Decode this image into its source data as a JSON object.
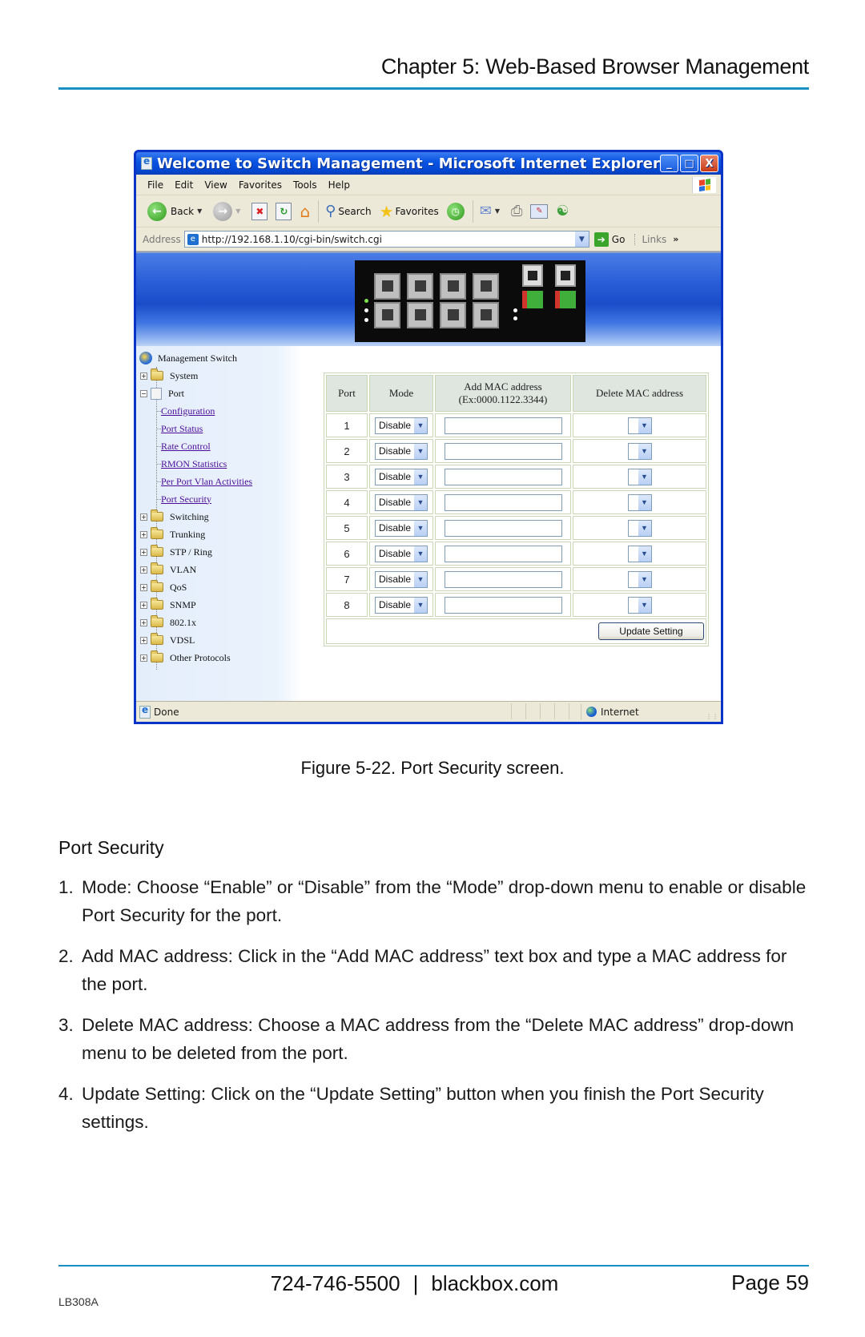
{
  "page_header": {
    "title": "Chapter 5: Web-Based Browser Management"
  },
  "browser": {
    "title": "Welcome to Switch Management - Microsoft Internet Explorer",
    "window_buttons": {
      "minimize": "_",
      "maximize": "□",
      "close": "X"
    },
    "menu": [
      "File",
      "Edit",
      "View",
      "Favorites",
      "Tools",
      "Help"
    ],
    "toolbar": {
      "back": "Back",
      "search": "Search",
      "favorites": "Favorites"
    },
    "address": {
      "label": "Address",
      "url": "http://192.168.1.10/cgi-bin/switch.cgi",
      "go": "Go",
      "links": "Links"
    },
    "status": {
      "text": "Done",
      "zone": "Internet"
    }
  },
  "sidebar": {
    "root": "Management Switch",
    "items": [
      {
        "label": "System",
        "expanded": false
      },
      {
        "label": "Port",
        "expanded": true,
        "children": [
          "Configuration",
          "Port Status",
          "Rate Control",
          "RMON Statistics",
          "Per Port Vlan Activities",
          "Port Security"
        ]
      },
      {
        "label": "Switching",
        "expanded": false
      },
      {
        "label": "Trunking",
        "expanded": false
      },
      {
        "label": "STP / Ring",
        "expanded": false
      },
      {
        "label": "VLAN",
        "expanded": false
      },
      {
        "label": "QoS",
        "expanded": false
      },
      {
        "label": "SNMP",
        "expanded": false
      },
      {
        "label": "802.1x",
        "expanded": false
      },
      {
        "label": "VDSL",
        "expanded": false
      },
      {
        "label": "Other Protocols",
        "expanded": false
      }
    ]
  },
  "port_table": {
    "headers": {
      "port": "Port",
      "mode": "Mode",
      "add_mac": "Add MAC address",
      "add_mac_example": "(Ex:0000.1122.3344)",
      "delete_mac": "Delete MAC address"
    },
    "rows": [
      {
        "port": "1",
        "mode": "Disable",
        "add_mac": "",
        "delete_mac": ""
      },
      {
        "port": "2",
        "mode": "Disable",
        "add_mac": "",
        "delete_mac": ""
      },
      {
        "port": "3",
        "mode": "Disable",
        "add_mac": "",
        "delete_mac": ""
      },
      {
        "port": "4",
        "mode": "Disable",
        "add_mac": "",
        "delete_mac": ""
      },
      {
        "port": "5",
        "mode": "Disable",
        "add_mac": "",
        "delete_mac": ""
      },
      {
        "port": "6",
        "mode": "Disable",
        "add_mac": "",
        "delete_mac": ""
      },
      {
        "port": "7",
        "mode": "Disable",
        "add_mac": "",
        "delete_mac": ""
      },
      {
        "port": "8",
        "mode": "Disable",
        "add_mac": "",
        "delete_mac": ""
      }
    ],
    "update_button": "Update Setting"
  },
  "caption": "Figure 5-22. Port Security screen.",
  "section": {
    "heading": "Port Security",
    "steps": [
      {
        "num": "1.",
        "text": "Mode: Choose “Enable” or “Disable” from the “Mode” drop-down menu to enable or disable Port Security for the port."
      },
      {
        "num": "2.",
        "text": "Add MAC address: Click in the “Add MAC address” text box and type a MAC address for the port."
      },
      {
        "num": "3.",
        "text": "Delete MAC address: Choose a MAC address from the “Delete MAC address” drop-down menu to be deleted from the port."
      },
      {
        "num": "4.",
        "text": "Update Setting: Click on the “Update Setting” button when you finish the Port Security settings."
      }
    ]
  },
  "footer": {
    "phone": "724-746-5500",
    "separator": "|",
    "website": "blackbox.com",
    "page": "Page 59",
    "doc_id": "LB308A"
  },
  "colors": {
    "accent_rule": "#1a8fc4",
    "xp_titlebar": "#0a55e3",
    "link": "#4b0c9a"
  }
}
